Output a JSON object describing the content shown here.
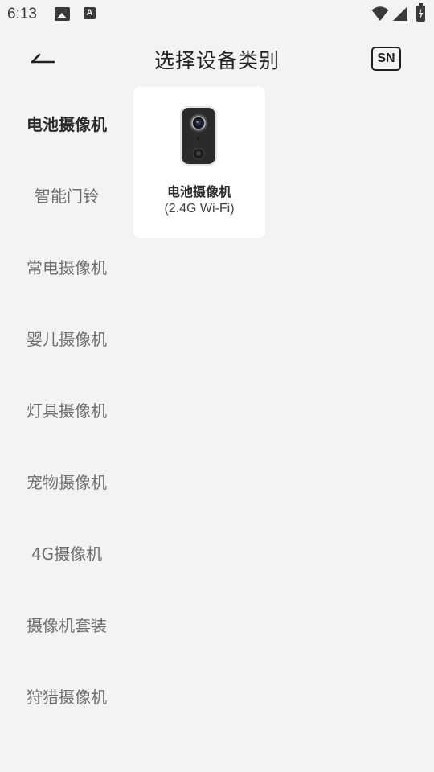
{
  "status_bar": {
    "time": "6:13",
    "icons": [
      "image-icon",
      "a-icon",
      "wifi-icon",
      "signal-icon",
      "battery-icon"
    ]
  },
  "header": {
    "back_icon": "arrow-left-icon",
    "title": "选择设备类别",
    "sn_label": "SN"
  },
  "categories": [
    {
      "label": "电池摄像机",
      "active": true
    },
    {
      "label": "智能门铃",
      "active": false
    },
    {
      "label": "常电摄像机",
      "active": false
    },
    {
      "label": "婴儿摄像机",
      "active": false
    },
    {
      "label": "灯具摄像机",
      "active": false
    },
    {
      "label": "宠物摄像机",
      "active": false
    },
    {
      "label": "4G摄像机",
      "active": false
    },
    {
      "label": "摄像机套装",
      "active": false
    },
    {
      "label": "狩猎摄像机",
      "active": false
    }
  ],
  "products": [
    {
      "name": "电池摄像机",
      "subtitle": "(2.4G Wi-Fi)",
      "icon": "battery-camera-icon"
    }
  ],
  "colors": {
    "background": "#f2f3f5",
    "card": "#ffffff",
    "active_text": "#2a2a2a",
    "inactive_text": "#6f6f6f"
  }
}
